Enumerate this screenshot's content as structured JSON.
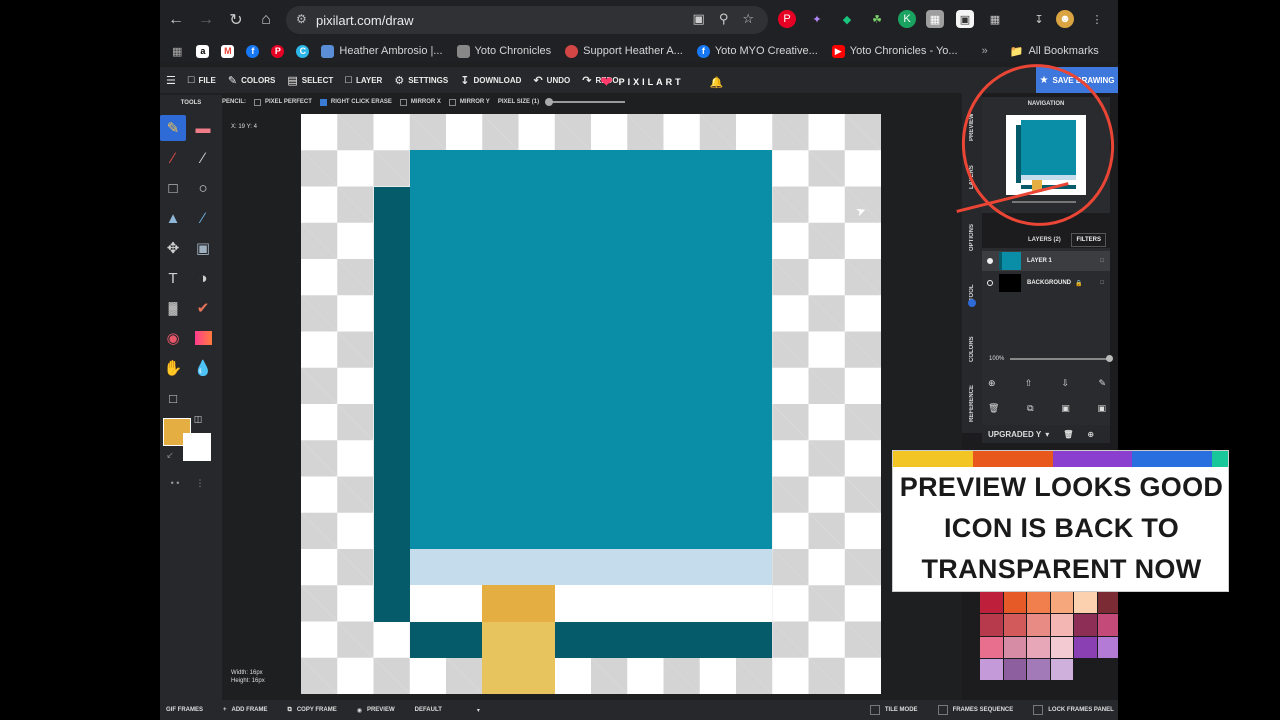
{
  "browser": {
    "url": "pixilart.com/draw",
    "bookmarks": [
      {
        "label": "Heather Ambrosio |...",
        "color": "#5a8fd8"
      },
      {
        "label": "Yoto Chronicles",
        "color": "#888888"
      },
      {
        "label": "Support Heather A...",
        "color": "#d24646"
      },
      {
        "label": "Yoto MYO Creative...",
        "color": "#1877f2"
      },
      {
        "label": "Yoto Chronicles - Yo...",
        "color": "#ff0000"
      }
    ],
    "all_bookmarks": "All Bookmarks"
  },
  "menu": {
    "file": "FILE",
    "colors": "COLORS",
    "select": "SELECT",
    "layer": "LAYER",
    "settings": "SETTINGS",
    "download": "DOWNLOAD",
    "undo": "UNDO",
    "redo": "REDO",
    "logo": "PIXILART",
    "save": "SAVE DRAWING"
  },
  "options": {
    "tool": "PENCIL:",
    "pixel_perfect": "PIXEL PERFECT",
    "right_click_erase": "RIGHT CLICK ERASE",
    "mirror_x": "MIRROR X",
    "mirror_y": "MIRROR Y",
    "pixel_size": "PIXEL SIZE (1)"
  },
  "tools": {
    "title": "TOOLS",
    "primary_color": "#e5ae43",
    "secondary_color": "#ffffff"
  },
  "canvas": {
    "coords": "X: 19 Y: 4",
    "width": "Width: 16px",
    "height": "Height: 16px",
    "colors": {
      "cover": "#0a8ea8",
      "spine": "#055b6a",
      "pages": "#c4dcec",
      "ribbon_top": "#e5ae43",
      "ribbon_bottom": "#e8c45e",
      "white": "#ffffff"
    }
  },
  "right_panel": {
    "navigation": "NAVIGATION",
    "tabs": [
      "PREVIEW",
      "LAYERS",
      "OPTIONS",
      "TOOL",
      "COLORS",
      "REFERENCE"
    ],
    "layers_title": "LAYERS (2)",
    "filters": "FILTERS",
    "layers": [
      {
        "name": "LAYER 1",
        "active": true
      },
      {
        "name": "BACKGROUND",
        "active": false
      }
    ],
    "opacity": "100%",
    "palette": "UPGRADED Y"
  },
  "callout": {
    "line1": "PREVIEW LOOKS GOOD",
    "line2": "ICON IS BACK TO",
    "line3": "TRANSPARENT NOW",
    "colors": [
      "#f3c524",
      "#e8581c",
      "#8a3fcf",
      "#2a6fe0",
      "#18c79a"
    ]
  },
  "bottom": {
    "gif_frames": "GIF FRAMES",
    "add_frame": "ADD FRAME",
    "copy_frame": "COPY FRAME",
    "preview": "PREVIEW",
    "speed": "DEFAULT",
    "tile_mode": "TILE MODE",
    "frames_sequence": "FRAMES SEQUENCE",
    "lock_frames": "LOCK FRAMES PANEL"
  }
}
